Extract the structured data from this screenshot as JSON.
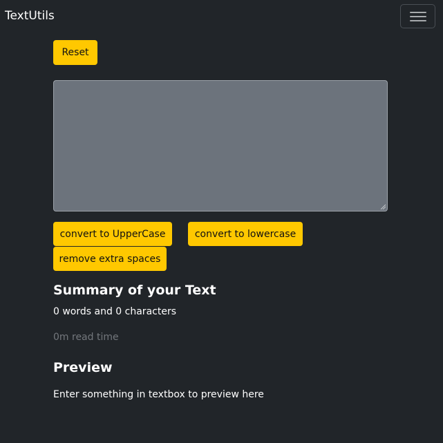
{
  "navbar": {
    "brand": "TextUtils",
    "toggler_icon": "hamburger-icon"
  },
  "actions": {
    "reset_label": "Reset",
    "uppercase_label": "convert to UpperCase",
    "lowercase_label": "convert to lowercase",
    "extra_spaces_label": "remove extra spaces"
  },
  "textbox": {
    "value": ""
  },
  "summary": {
    "heading": "Summary of your Text",
    "counts": "0 words and 0 characters",
    "read_time": "0m read time"
  },
  "preview": {
    "heading": "Preview",
    "text": "Enter something in textbox to preview here"
  },
  "colors": {
    "background": "#212529",
    "accent": "#ffc800",
    "textbox": "#6c737c",
    "muted": "#73777c"
  }
}
